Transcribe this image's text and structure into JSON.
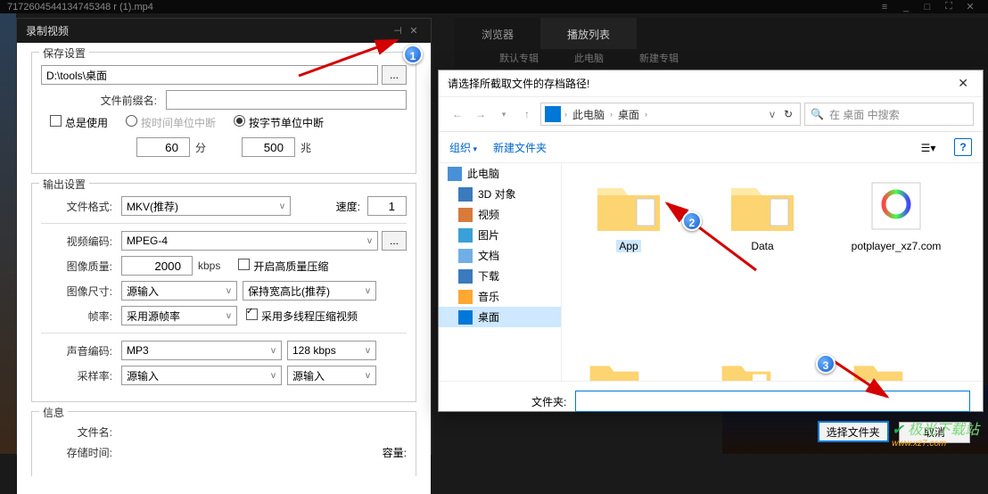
{
  "player": {
    "title": "7172604544134745348 r (1).mp4",
    "tabs": {
      "browser": "浏览器",
      "playlist": "播放列表"
    },
    "subtabs": [
      "默认专辑",
      "此电脑",
      "新建专辑"
    ]
  },
  "record": {
    "title": "录制视频",
    "save_section": "保存设置",
    "path": "D:\\tools\\桌面",
    "browse": "...",
    "prefix_label": "文件前缀名:",
    "always_use": "总是使用",
    "break_time": "按时间单位中断",
    "break_byte": "按字节单位中断",
    "time_val": "60",
    "time_unit": "分",
    "byte_val": "500",
    "byte_unit": "兆",
    "output_section": "输出设置",
    "format_label": "文件格式:",
    "format_val": "MKV(推荐)",
    "speed_label": "速度:",
    "speed_val": "1",
    "vcodec_label": "视频编码:",
    "vcodec_val": "MPEG-4",
    "vcodec_more": "...",
    "quality_label": "图像质量:",
    "quality_val": "2000",
    "quality_unit": "kbps",
    "hq_compress": "开启高质量压缩",
    "size_label": "图像尺寸:",
    "size_val": "源输入",
    "aspect_val": "保持宽高比(推荐)",
    "fps_label": "帧率:",
    "fps_val": "采用源帧率",
    "multithread": "采用多线程压缩视频",
    "acodec_label": "声音编码:",
    "acodec_val": "MP3",
    "abitrate": "128 kbps",
    "sample_label": "采样率:",
    "sample_val": "源输入",
    "sample2_val": "源输入",
    "info_section": "信息",
    "filename_label": "文件名:",
    "savetime_label": "存储时间:",
    "capacity_label": "容量:"
  },
  "dialog": {
    "title": "请选择所截取文件的存档路径!",
    "breadcrumb": {
      "pc": "此电脑",
      "desktop": "桌面"
    },
    "refresh": "↻",
    "search_placeholder": "在 桌面 中搜索",
    "organize": "组织",
    "new_folder": "新建文件夹",
    "side": {
      "pc": "此电脑",
      "3d": "3D 对象",
      "video": "视频",
      "pic": "图片",
      "doc": "文档",
      "dl": "下载",
      "music": "音乐",
      "desktop": "桌面"
    },
    "folders": {
      "app": "App",
      "data": "Data",
      "pot": "potplayer_xz7.com"
    },
    "folder_label": "文件夹:",
    "select_btn": "选择文件夹",
    "cancel_btn": "取消"
  },
  "watermark": {
    "name": "极光下载站",
    "url": "www.xz7.com"
  }
}
